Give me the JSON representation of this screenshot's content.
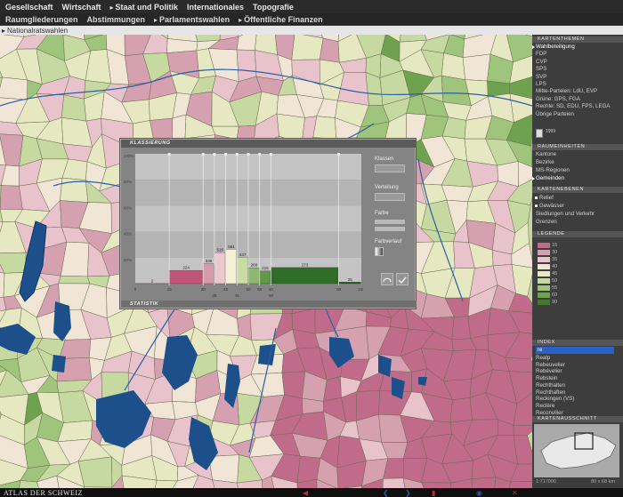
{
  "menu": {
    "top": [
      "Gesellschaft",
      "Wirtschaft",
      "Staat und Politik",
      "Internationales",
      "Topografie"
    ],
    "sub": [
      "Raumgliederungen",
      "Abstimmungen",
      "Parlamentswahlen",
      "Öffentliche Finanzen"
    ],
    "breadcrumb": "Nationalratswahlen"
  },
  "panel": {
    "kartenthemen": {
      "title": "KARTENTHEMEN",
      "items": [
        "Wahlbeteiligung",
        "FDP",
        "CVP",
        "SPS",
        "SVP",
        "LPS",
        "Mitte-Parteien: LdU, EVP",
        "Grüne: GPS, FGA",
        "Rechte: SD, EDU, FPS, LEGA",
        "Übrige Parteien"
      ],
      "selected": 0,
      "year": "1999"
    },
    "raumeinheiten": {
      "title": "RAUMEINHEITEN",
      "items": [
        "Kantone",
        "Bezirke",
        "MS-Regionen",
        "Gemeinden"
      ],
      "selected": 3
    },
    "kartenebenen": {
      "title": "KARTENEBENEN",
      "items": [
        "Relief",
        "Gewässer",
        "Siedlungen und Verkehr",
        "Grenzen"
      ],
      "checked": [
        0,
        1
      ]
    },
    "legende": {
      "title": "LEGENDE",
      "labels": [
        "15",
        "30",
        "35",
        "40",
        "45",
        "50",
        "55",
        "60",
        "90"
      ],
      "colors": [
        "#c06b8a",
        "#d5a0b0",
        "#e8c3cc",
        "#f1e6d6",
        "#e6e8c2",
        "#c5d9a0",
        "#9fc47b",
        "#6fa24f",
        "#3f7a2f"
      ]
    },
    "index": {
      "title": "INDEX",
      "input": "re",
      "items": [
        "Realp",
        "Rebeuvelier",
        "Rebévelier",
        "Rebstein",
        "Rechthalten",
        "Rechthaften",
        "Reckingen (VS)",
        "Reclère",
        "Reconvilier"
      ]
    },
    "kartenausschnitt": {
      "title": "KARTENAUSSCHNITT",
      "scale": "1:717000",
      "extent": "80 x 68 km"
    }
  },
  "klassierung": {
    "title": "KLASSIERUNG",
    "footer": "STATISTIK",
    "y_ticks": [
      "100%",
      "80%",
      "60%",
      "40%",
      "20%"
    ],
    "controls": {
      "klassen": "Klassen",
      "verteilung": "Verteilung",
      "farbe": "Farbe",
      "farbverlauf": "Farbverlauf"
    }
  },
  "chart_data": {
    "type": "bar",
    "title": "KLASSIERUNG",
    "bins": [
      {
        "from": 0,
        "to": 15,
        "count": 2,
        "color": "#b04b6a"
      },
      {
        "from": 15,
        "to": 30,
        "count": 224,
        "color": "#c0557a"
      },
      {
        "from": 30,
        "to": 35,
        "count": 339,
        "color": "#d59aab"
      },
      {
        "from": 35,
        "to": 40,
        "count": 526,
        "color": "#ecc8cf"
      },
      {
        "from": 40,
        "to": 45,
        "count": 581,
        "color": "#f5f1d6"
      },
      {
        "from": 45,
        "to": 50,
        "count": 447,
        "color": "#c9dca2"
      },
      {
        "from": 50,
        "to": 55,
        "count": 269,
        "color": "#8fb86f"
      },
      {
        "from": 55,
        "to": 60,
        "count": 215,
        "color": "#5f9846"
      },
      {
        "from": 60,
        "to": 90,
        "count": 273,
        "color": "#2f6e26"
      },
      {
        "from": 90,
        "to": 100,
        "count": 25,
        "color": "#1f5a1b"
      }
    ],
    "x_ticks_top": [
      "0",
      "15",
      "30",
      "40",
      "50",
      "55",
      "60",
      "90",
      "100"
    ],
    "x_ticks_bottom": [
      "35",
      "45",
      "60"
    ],
    "xlim": [
      0,
      100
    ]
  }
}
